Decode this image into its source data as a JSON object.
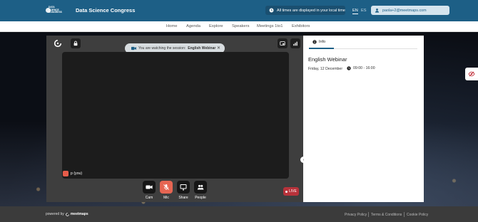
{
  "header": {
    "logo_text": "DATA\nSCIENCE\nCONGRESS",
    "app_title": "Data Science Congress",
    "timezone_note": "All times are displayed in your local time",
    "languages": [
      "EN",
      "ES"
    ],
    "active_language": "EN",
    "user_email": "paola+2@meetmaps.com"
  },
  "nav": {
    "items": [
      "Home",
      "Agenda",
      "Explore",
      "Speakers",
      "Meetings 1to1",
      "Exhibitors"
    ]
  },
  "player": {
    "banner_prefix": "You are watching the session:",
    "banner_session": "English Webinar",
    "participant_label": "p (you)",
    "controls": [
      {
        "label": "Cam",
        "icon": "camera-icon"
      },
      {
        "label": "Mic",
        "icon": "mic-off-icon",
        "state": "muted"
      },
      {
        "label": "Share",
        "icon": "screen-share-icon"
      },
      {
        "label": "People",
        "icon": "people-icon"
      }
    ],
    "live_label": "LIVE"
  },
  "panel": {
    "tab_label": "Info",
    "session_title": "English Webinar",
    "session_date": "Friday, 12 December",
    "session_time": "09:00 - 16:00"
  },
  "footer": {
    "powered_by": "powered by",
    "brand": "meetmaps",
    "links": [
      "Privacy Policy",
      "Terms & Conditions",
      "Cookie Policy"
    ]
  },
  "colors": {
    "header_bg": "#1d5f86",
    "mic_muted": "#e66552",
    "live_badge": "#b7323a",
    "footer_bg": "#3b3b3b"
  }
}
